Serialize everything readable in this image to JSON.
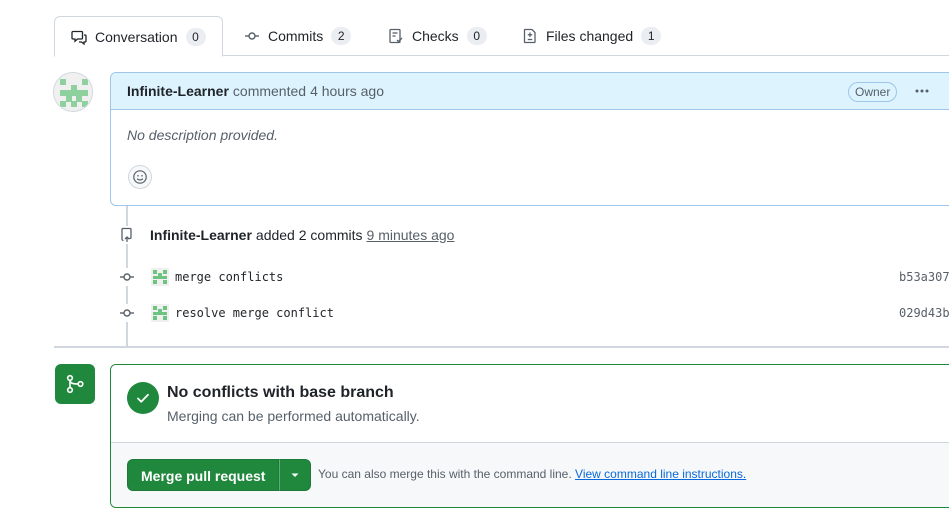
{
  "tabs": [
    {
      "label": "Conversation",
      "count": "0",
      "icon": "comment-discussion-icon"
    },
    {
      "label": "Commits",
      "count": "2",
      "icon": "git-commit-icon"
    },
    {
      "label": "Checks",
      "count": "0",
      "icon": "checklist-icon"
    },
    {
      "label": "Files changed",
      "count": "1",
      "icon": "file-diff-icon"
    }
  ],
  "comment": {
    "author": "Infinite-Learner",
    "action": "commented",
    "time": "4 hours ago",
    "badge": "Owner",
    "body": "No description provided."
  },
  "commits_event": {
    "author": "Infinite-Learner",
    "action": "added 2 commits",
    "time": "9 minutes ago"
  },
  "commits": [
    {
      "message": "merge conflicts",
      "sha": "b53a307"
    },
    {
      "message": "resolve merge conflict",
      "sha": "029d43b"
    }
  ],
  "merge": {
    "title": "No conflicts with base branch",
    "subtitle": "Merging can be performed automatically.",
    "button": "Merge pull request",
    "hint": "You can also merge this with the command line.",
    "hint_link": "View command line instructions."
  },
  "colors": {
    "accent_green": "#1f883d",
    "link_blue": "#0969da",
    "header_blue": "#ddf4ff"
  }
}
